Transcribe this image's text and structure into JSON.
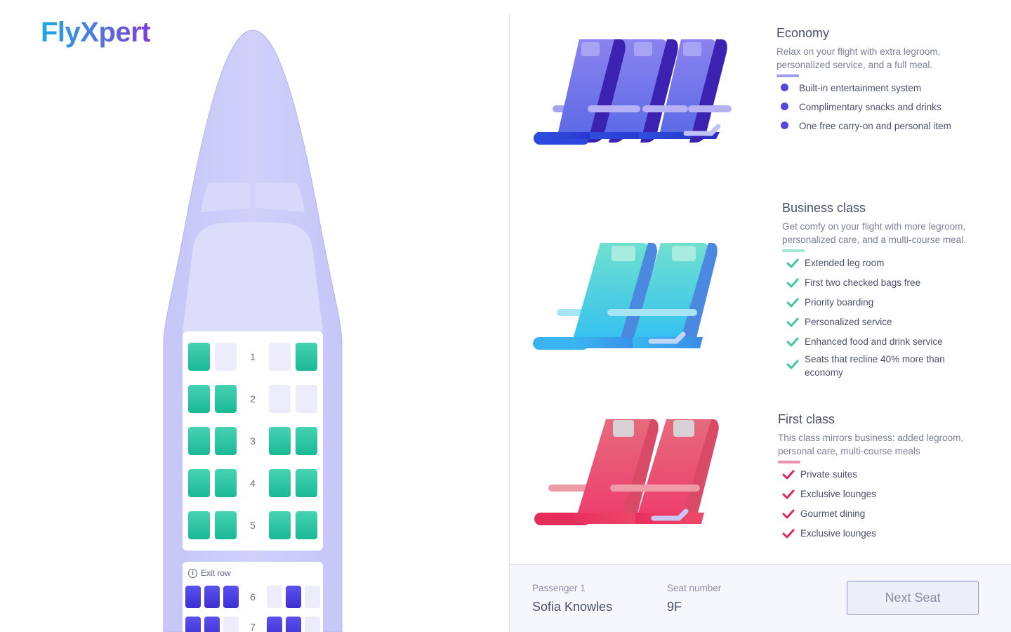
{
  "brand": {
    "name": "FlyXpert"
  },
  "seat_map": {
    "exit_row_label": "Exit row",
    "rows": [
      {
        "number": "1",
        "seats": [
          "available",
          "taken",
          "taken",
          "available"
        ]
      },
      {
        "number": "2",
        "seats": [
          "available",
          "available",
          "taken",
          "taken"
        ]
      },
      {
        "number": "3",
        "seats": [
          "available",
          "available",
          "available",
          "available"
        ]
      },
      {
        "number": "4",
        "seats": [
          "available",
          "available",
          "available",
          "available"
        ]
      },
      {
        "number": "5",
        "seats": [
          "available",
          "available",
          "available",
          "available"
        ]
      },
      {
        "number": "6",
        "seats": [
          "exit",
          "exit",
          "exit",
          "taken",
          "exit",
          "taken"
        ]
      },
      {
        "number": "7",
        "seats": [
          "exit",
          "exit",
          "taken",
          "exit",
          "exit",
          "taken"
        ]
      }
    ]
  },
  "classes": {
    "economy": {
      "title": "Economy",
      "description": "Relax on your flight with extra legroom, personalized service, and a full meal.",
      "accent": "#a19cf0",
      "bullet_color": "#5548e2",
      "features": [
        "Built-in entertainment system",
        "Complimentary snacks and drinks",
        "One free carry-on and personal item"
      ]
    },
    "business": {
      "title": "Business class",
      "description": "Get comfy on your flight with more legroom, personalized care, and a multi-course meal.",
      "accent": "#9ce8d6",
      "check_color": "#3cc9a2",
      "features": [
        "Extended leg room",
        "First two checked bags free",
        "Priority boarding",
        "Personalized service",
        "Enhanced food and drink service",
        "Seats that recline 40% more than economy"
      ]
    },
    "first": {
      "title": "First class",
      "description": "This class mirrors business: added legroom, personal care, multi-course meals",
      "accent": "#ef8fae",
      "check_color": "#e0285e",
      "features": [
        "Private suites",
        "Exclusive lounges",
        "Gourmet dining",
        "Exclusive lounges"
      ]
    }
  },
  "footer": {
    "passenger_label": "Passenger 1",
    "passenger_name": "Sofia Knowles",
    "seat_label": "Seat number",
    "seat_value": "9F",
    "next_button": "Next Seat"
  },
  "icons": {
    "info": "info-icon",
    "check": "check-icon",
    "bullet": "bullet-dot-icon"
  }
}
